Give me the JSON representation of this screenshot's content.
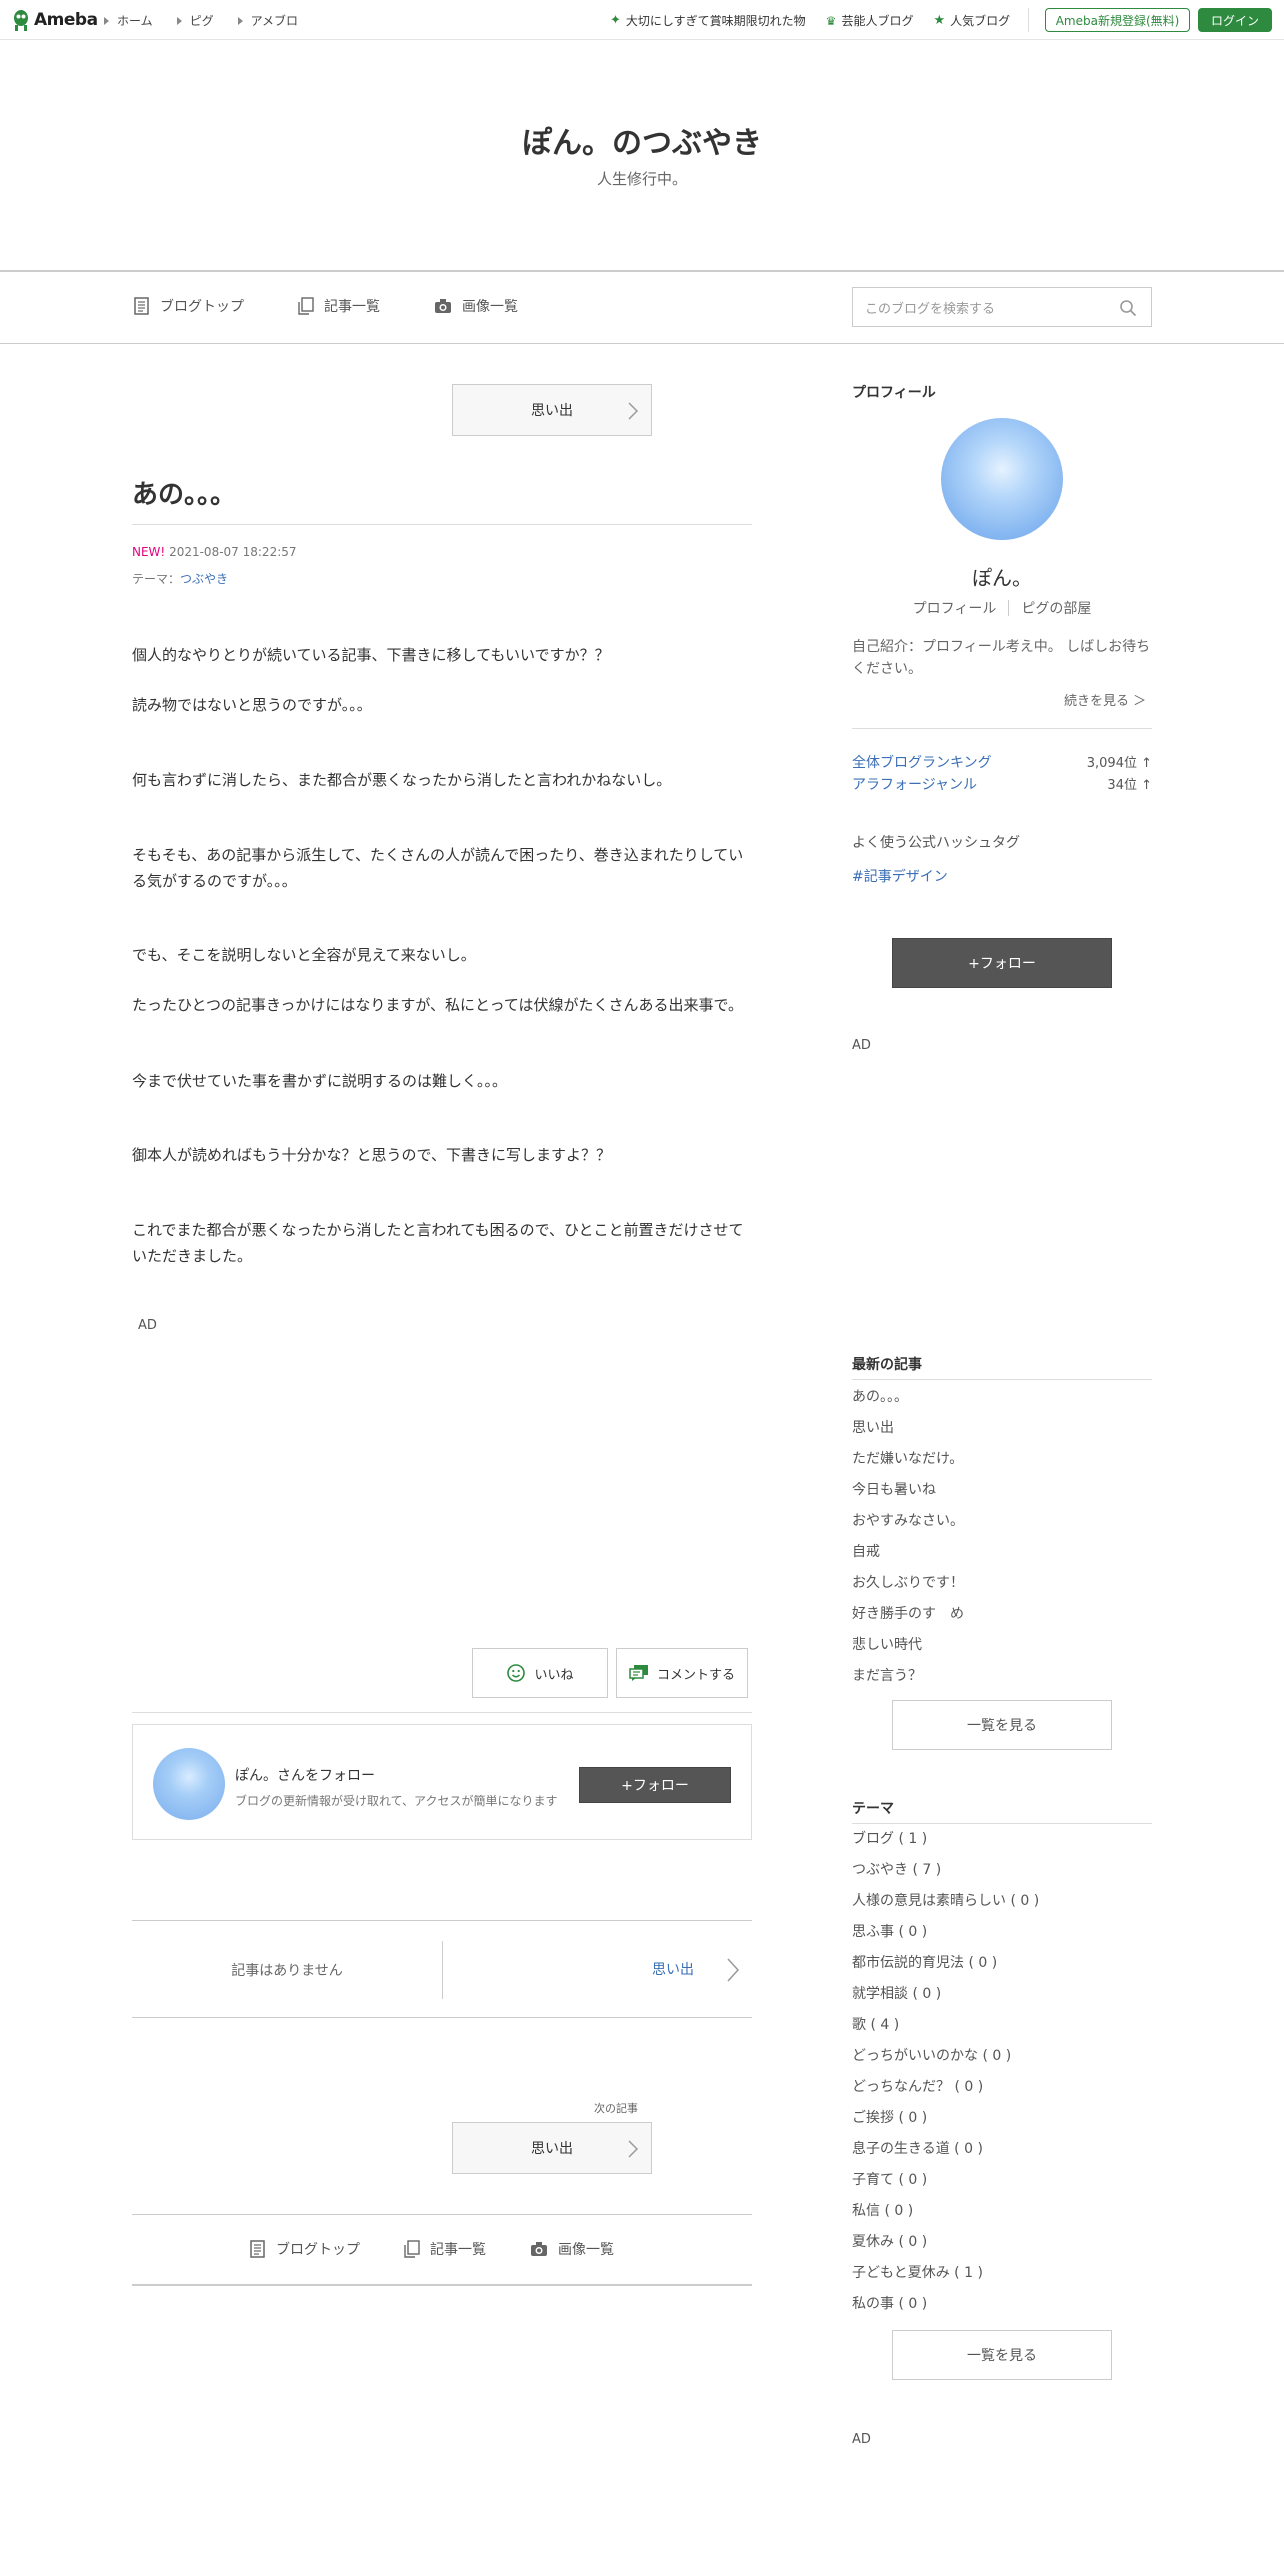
{
  "topbar": {
    "logo_text": "Ameba",
    "nav": [
      "ホーム",
      "ピグ",
      "アメブロ"
    ],
    "links": [
      "大切にしすぎて賞味期限切れた物",
      "芸能人ブログ",
      "人気ブログ"
    ],
    "register_label": "Ameba新規登録(無料)",
    "login_label": "ログイン",
    "accent_color": "#2d8a3e"
  },
  "header": {
    "title": "ぽん。のつぶやき",
    "subtitle": "人生修行中。"
  },
  "navbar": {
    "items": [
      {
        "label": "ブログトップ",
        "icon": "document-icon"
      },
      {
        "label": "記事一覧",
        "icon": "copy-icon"
      },
      {
        "label": "画像一覧",
        "icon": "camera-icon"
      }
    ],
    "search_placeholder": "このブログを検索する"
  },
  "article": {
    "theme_button": "思い出",
    "title": "あの。。。",
    "new_badge": "NEW!",
    "datetime": "2021-08-07 18:22:57",
    "theme_prefix": "テーマ：",
    "theme": "つぶやき",
    "paragraphs": [
      "個人的なやりとりが続いている記事、下書きに移してもいいですか？？",
      "読み物ではないと思うのですが。。。",
      "何も言わずに消したら、また都合が悪くなったから消したと言われかねないし。",
      "そもそも、あの記事から派生して、たくさんの人が読んで困ったり、巻き込まれたりしている気がするのですが。。。",
      "でも、そこを説明しないと全容が見えて来ないし。",
      "たったひとつの記事きっかけにはなりますが、私にとっては伏線がたくさんある出来事で。",
      "今まで伏せていた事を書かずに説明するのは難しく。。。",
      "御本人が読めればもう十分かな？と思うので、下書きに写しますよ？？",
      "これでまた都合が悪くなったから消したと言われても困るので、ひとこと前置きだけさせていただきました。"
    ],
    "ad_label": "AD",
    "like_label": "いいね",
    "comment_label": "コメントする"
  },
  "follow_box": {
    "name": "ぽん。さんをフォロー",
    "desc": "ブログの更新情報が受け取れて、アクセスが簡単になります",
    "button": "+フォロー"
  },
  "pager": {
    "prev": "記事はありません",
    "next": "思い出",
    "next_label": "次の記事",
    "next_button": "思い出"
  },
  "sidebar": {
    "profile_head": "プロフィール",
    "name": "ぽん。",
    "links": [
      "プロフィール",
      "ピグの部屋"
    ],
    "intro": "自己紹介：プロフィール考え中。 しばしお待ちください。",
    "readmore": "続きを見る ＞",
    "ranking": [
      {
        "label": "全体ブログランキング",
        "value": "3,094位 ↑"
      },
      {
        "label": "アラフォージャンル",
        "value": "34位 ↑"
      }
    ],
    "hashtag_head": "よく使う公式ハッシュタグ",
    "hashtag": "#記事デザイン",
    "follow_button": "+フォロー",
    "ad_label": "AD",
    "latest_head": "最新の記事",
    "latest": [
      "あの。。。",
      "思い出",
      "ただ嫌いなだけ。",
      "今日も暑いね",
      "おやすみなさい。",
      "自戒",
      "お久しぶりです！",
      "好き勝手のす　め",
      "悲しい時代",
      "まだ言う？"
    ],
    "latest_more": "一覧を見る",
    "theme_head": "テーマ",
    "themes": [
      "ブログ ( 1 )",
      "つぶやき ( 7 )",
      "人様の意見は素晴らしい ( 0 )",
      "思ふ事 ( 0 )",
      "都市伝説的育児法 ( 0 )",
      "就学相談 ( 0 )",
      "歌 ( 4 )",
      "どっちがいいのかな ( 0 )",
      "どっちなんだ？ ( 0 )",
      "ご挨拶 ( 0 )",
      "息子の生きる道 ( 0 )",
      "子育て ( 0 )",
      "私信 ( 0 )",
      "夏休み ( 0 )",
      "子どもと夏休み ( 1 )",
      "私の事 ( 0 )"
    ],
    "themes_more": "一覧を見る",
    "ad_label2": "AD"
  }
}
